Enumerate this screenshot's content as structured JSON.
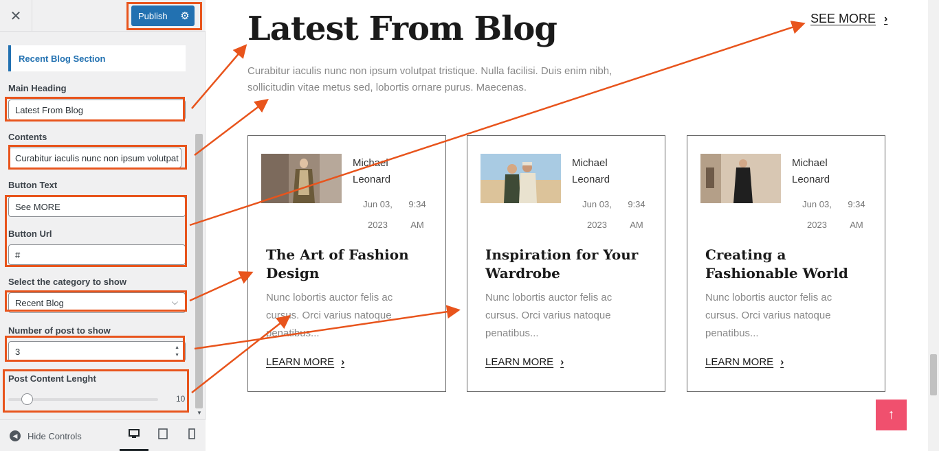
{
  "customizer": {
    "close_icon": "close-icon",
    "publish_label": "Publish",
    "section_title": "Recent Blog Section",
    "main_heading_label": "Main Heading",
    "main_heading_value": "Latest From Blog",
    "contents_label": "Contents",
    "contents_value": "Curabitur iaculis nunc non ipsum volutpat",
    "button_text_label": "Button Text",
    "button_text_value": "See MORE",
    "button_url_label": "Button Url",
    "button_url_value": "#",
    "category_label": "Select the category to show",
    "category_value": "Recent Blog",
    "post_count_label": "Number of post to show",
    "post_count_value": "3",
    "content_length_label": "Post Content Lenght",
    "content_length_value": "10",
    "hide_controls_label": "Hide Controls"
  },
  "preview": {
    "heading": "Latest From Blog",
    "see_more": "SEE MORE",
    "intro": "Curabitur iaculis nunc non ipsum volutpat tristique. Nulla facilisi. Duis enim nibh, sollicitudin vitae metus sed, lobortis ornare purus. Maecenas.",
    "cards": [
      {
        "author_first": "Michael",
        "author_last": "Leonard",
        "date_line1": "Jun 03,",
        "date_line2": "2023",
        "time_line1": "9:34",
        "time_line2": "AM",
        "title": "The Art of Fashion Design",
        "excerpt": "Nunc lobortis auctor felis ac cursus. Orci varius natoque penatibus...",
        "learn_more": "LEARN MORE"
      },
      {
        "author_first": "Michael",
        "author_last": "Leonard",
        "date_line1": "Jun 03,",
        "date_line2": "2023",
        "time_line1": "9:34",
        "time_line2": "AM",
        "title": "Inspiration for Your Wardrobe",
        "excerpt": "Nunc lobortis auctor felis ac cursus. Orci varius natoque penatibus...",
        "learn_more": "LEARN MORE"
      },
      {
        "author_first": "Michael",
        "author_last": "Leonard",
        "date_line1": "Jun 03,",
        "date_line2": "2023",
        "time_line1": "9:34",
        "time_line2": "AM",
        "title": "Creating a Fashionable World",
        "excerpt": "Nunc lobortis auctor felis ac cursus. Orci varius natoque penatibus...",
        "learn_more": "LEARN MORE"
      }
    ]
  },
  "colors": {
    "accent": "#2271b1",
    "annotation": "#e8541c",
    "back_to_top": "#f0506e"
  }
}
